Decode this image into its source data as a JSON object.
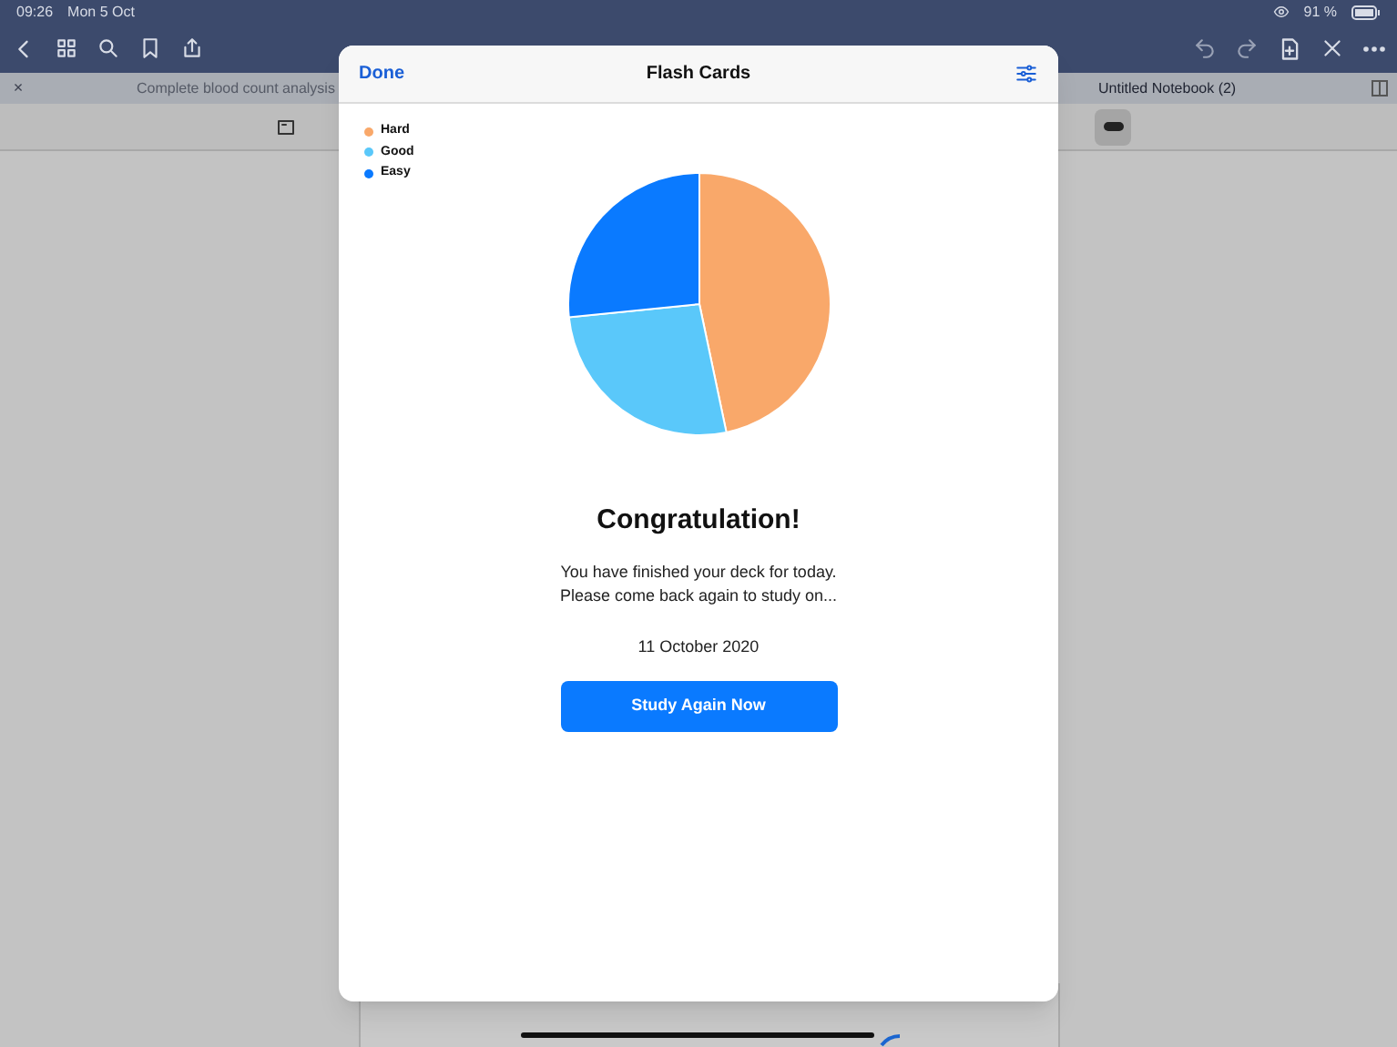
{
  "status_bar": {
    "time": "09:26",
    "date": "Mon 5 Oct",
    "battery": "91 %"
  },
  "app": {
    "tabs": [
      {
        "label": "Complete blood count analysis",
        "selected": false
      },
      {
        "label": "Untitled Notebook (2)",
        "selected": true
      }
    ],
    "close_tab": "×"
  },
  "modal": {
    "done": "Done",
    "title": "Flash Cards",
    "legend": [
      {
        "label": "Hard",
        "color": "#f9a86a"
      },
      {
        "label": "Good",
        "color": "#5ac8fa"
      },
      {
        "label": "Easy",
        "color": "#0a7aff"
      }
    ],
    "heading": "Congratulation!",
    "message_lines": [
      "You have finished your deck for today.",
      "Please come back again to study on..."
    ],
    "date": "11 October 2020",
    "button": "Study Again Now"
  }
}
